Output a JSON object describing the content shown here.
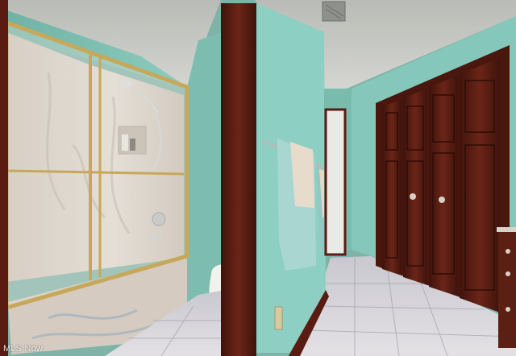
{
  "photo": {
    "subject": "bathroom",
    "watermark": "MLS Now",
    "colors": {
      "wall": "#8ccfc1",
      "ceiling": "#c9cbc6",
      "wood": "#5a1c12",
      "floor_tile": "#d8d6da",
      "shower_tile": "#d9cfc4",
      "brass": "#c7a85a",
      "towel": "#a9d6d0"
    }
  }
}
